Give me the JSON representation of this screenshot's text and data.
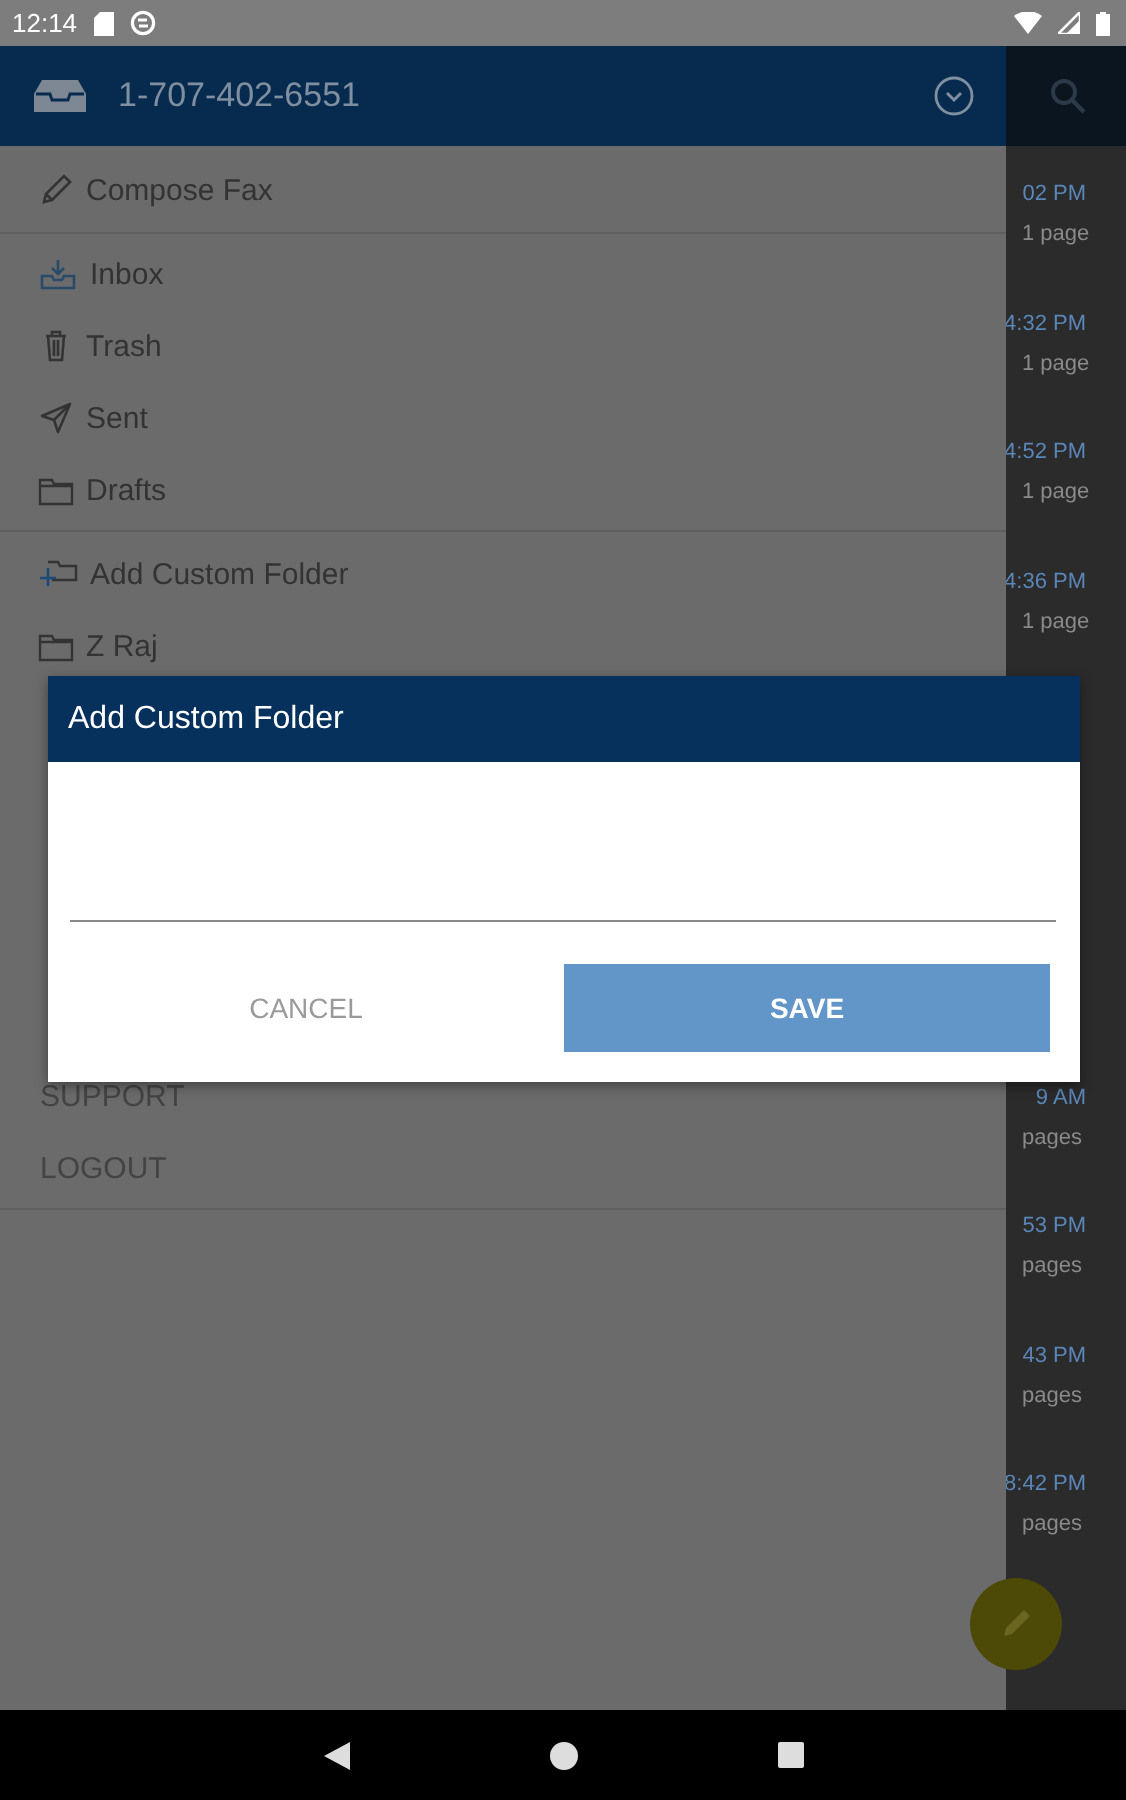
{
  "status_bar": {
    "time": "12:14"
  },
  "drawer": {
    "account": "1-707-402-6551",
    "sections": [
      {
        "items": [
          {
            "kind": "compose",
            "label": "Compose Fax"
          }
        ]
      },
      {
        "items": [
          {
            "kind": "inbox",
            "label": "Inbox"
          },
          {
            "kind": "trash",
            "label": "Trash"
          },
          {
            "kind": "sent",
            "label": "Sent"
          },
          {
            "kind": "folder",
            "label": "Drafts"
          }
        ]
      },
      {
        "items": [
          {
            "kind": "add-folder",
            "label": "Add Custom Folder"
          },
          {
            "kind": "folder",
            "label": "Z Raj"
          }
        ]
      }
    ],
    "bottom_items": [
      {
        "kind": "text",
        "label": "SUPPORT"
      },
      {
        "kind": "text",
        "label": "LOGOUT"
      }
    ]
  },
  "fax_list": {
    "rows": [
      {
        "time": "02 PM",
        "pages": "1 page"
      },
      {
        "time": "4:32 PM",
        "pages": "1 page"
      },
      {
        "time": "4:52 PM",
        "pages": "1 page"
      },
      {
        "time": "4:36 PM",
        "pages": "1 page"
      },
      {
        "time": "9 AM",
        "pages": "pages"
      },
      {
        "time": "53 PM",
        "pages": "pages"
      },
      {
        "time": "43 PM",
        "pages": "pages"
      },
      {
        "time": "8:42 PM",
        "pages": "pages"
      }
    ]
  },
  "dialog": {
    "title": "Add Custom Folder",
    "buttons": [
      {
        "kind": "cancel",
        "label": "CANCEL"
      },
      {
        "kind": "save",
        "label": "SAVE"
      }
    ]
  }
}
